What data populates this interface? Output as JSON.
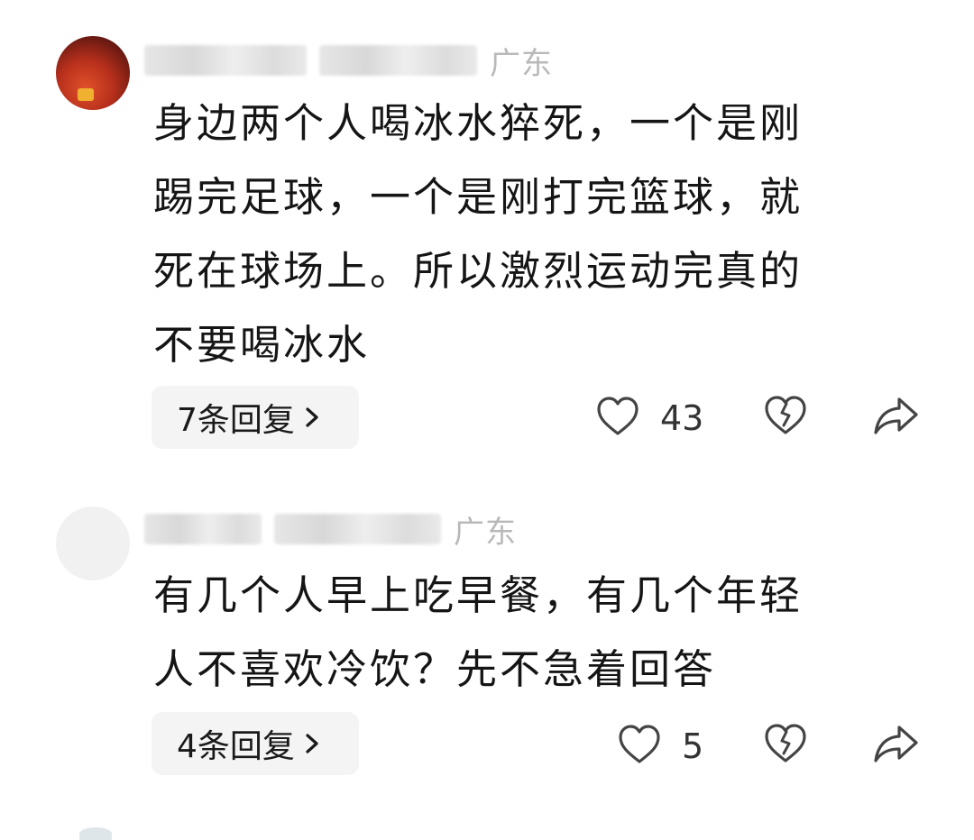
{
  "comments": [
    {
      "location": "广东",
      "text": "身边两个人喝冰水猝死，一个是刚踢完足球，一个是刚打完篮球，就死在球场上。所以激烈运动完真的不要喝冰水",
      "lines": [
        "身边两个人喝冰水猝死，一个是刚",
        "踢完足球，一个是刚打完篮球，就",
        "死在球场上。所以激烈运动完真的",
        "不要喝冰水"
      ],
      "replies_label": "7条回复",
      "likes": "43",
      "icons": {
        "like": "heart-outline-icon",
        "dislike": "broken-heart-icon",
        "share": "share-arrow-icon",
        "chevron": "chevron-right-icon"
      }
    },
    {
      "location": "广东",
      "text": "有几个人早上吃早餐，有几个年轻人不喜欢冷饮？先不急着回答",
      "lines": [
        "有几个人早上吃早餐，有几个年轻",
        "人不喜欢冷饮？先不急着回答"
      ],
      "replies_label": "4条回复",
      "likes": "5",
      "icons": {
        "like": "heart-outline-icon",
        "dislike": "broken-heart-icon",
        "share": "share-arrow-icon",
        "chevron": "chevron-right-icon"
      }
    }
  ],
  "colors": {
    "text": "#151515",
    "location": "#b9b9b9",
    "pill_bg": "#f4f4f4",
    "icon": "#444444"
  }
}
